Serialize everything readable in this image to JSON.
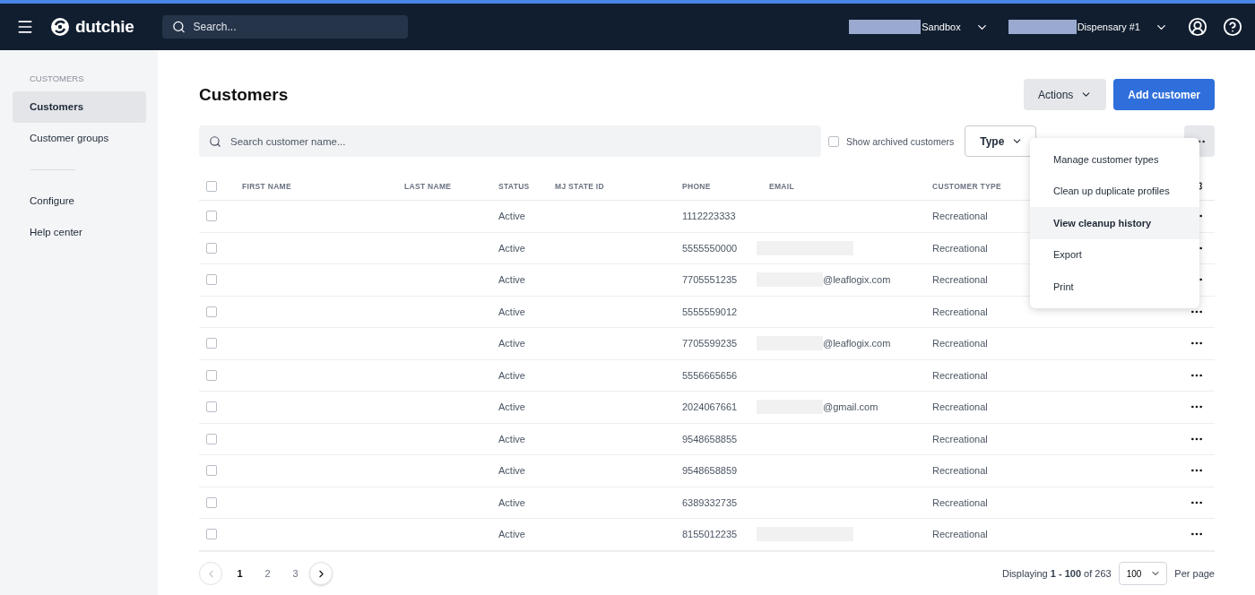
{
  "topbar": {
    "logo": "dutchie",
    "search": {
      "placeholder": "Search..."
    },
    "selectors": [
      {
        "label": "Sandbox",
        "redacted": true
      },
      {
        "label": "Dispensary #1",
        "redacted": true
      }
    ]
  },
  "sidebar": {
    "section": "CUSTOMERS",
    "items": [
      {
        "label": "Customers",
        "selected": true
      },
      {
        "label": "Customer groups",
        "selected": false
      }
    ],
    "footer_items": [
      {
        "label": "Configure",
        "selected": false
      },
      {
        "label": "Help center",
        "selected": false
      }
    ]
  },
  "page": {
    "title": "Customers",
    "actions_button": "Actions",
    "add_button": "Add customer"
  },
  "filters": {
    "search": {
      "placeholder": "Search customer name..."
    },
    "archived": {
      "label": "Show archived customers",
      "checked": false
    },
    "type_dropdown": "Type"
  },
  "actions_menu": [
    {
      "label": "Manage customer types",
      "selected": false
    },
    {
      "label": "Clean up duplicate profiles",
      "selected": false
    },
    {
      "label": "View cleanup history",
      "selected": true
    },
    {
      "label": "Export",
      "selected": false
    },
    {
      "label": "Print",
      "selected": false
    }
  ],
  "table": {
    "select_all_checked": false,
    "columns": [
      "FIRST NAME",
      "LAST NAME",
      "STATUS",
      "MJ STATE ID",
      "PHONE",
      "EMAIL",
      "CUSTOMER TYPE"
    ],
    "rows": [
      {
        "checked": false,
        "status": "Active",
        "phone": "1112223333",
        "type": "Recreational"
      },
      {
        "checked": false,
        "status": "Active",
        "phone": "5555550000",
        "email": {
          "redacted": true
        },
        "type": "Recreational"
      },
      {
        "checked": false,
        "status": "Active",
        "phone": "7705551235",
        "email": {
          "text": "@leaflogix.com",
          "redacted": true
        },
        "type": "Recreational"
      },
      {
        "checked": false,
        "status": "Active",
        "phone": "5555559012",
        "type": "Recreational"
      },
      {
        "checked": false,
        "status": "Active",
        "phone": "7705599235",
        "email": {
          "text": "@leaflogix.com",
          "redacted": true
        },
        "type": "Recreational"
      },
      {
        "checked": false,
        "status": "Active",
        "phone": "5556665656",
        "type": "Recreational"
      },
      {
        "checked": false,
        "status": "Active",
        "phone": "2024067661",
        "email": {
          "text": "@gmail.com",
          "redacted": true
        },
        "type": "Recreational"
      },
      {
        "checked": false,
        "status": "Active",
        "phone": "9548658855",
        "type": "Recreational"
      },
      {
        "checked": false,
        "status": "Active",
        "phone": "9548658859",
        "type": "Recreational"
      },
      {
        "checked": false,
        "status": "Active",
        "phone": "6389332735",
        "type": "Recreational"
      },
      {
        "checked": false,
        "status": "Active",
        "phone": "8155012235",
        "email": {
          "redacted": true
        },
        "type": "Recreational"
      }
    ]
  },
  "pagination": {
    "pages": [
      {
        "label": "1",
        "selected": true
      },
      {
        "label": "2",
        "selected": false
      },
      {
        "label": "3",
        "selected": false
      }
    ],
    "summary": "Displaying **1 - 100** of 263",
    "per_page_value": "100",
    "per_page_label": "Per page"
  }
}
